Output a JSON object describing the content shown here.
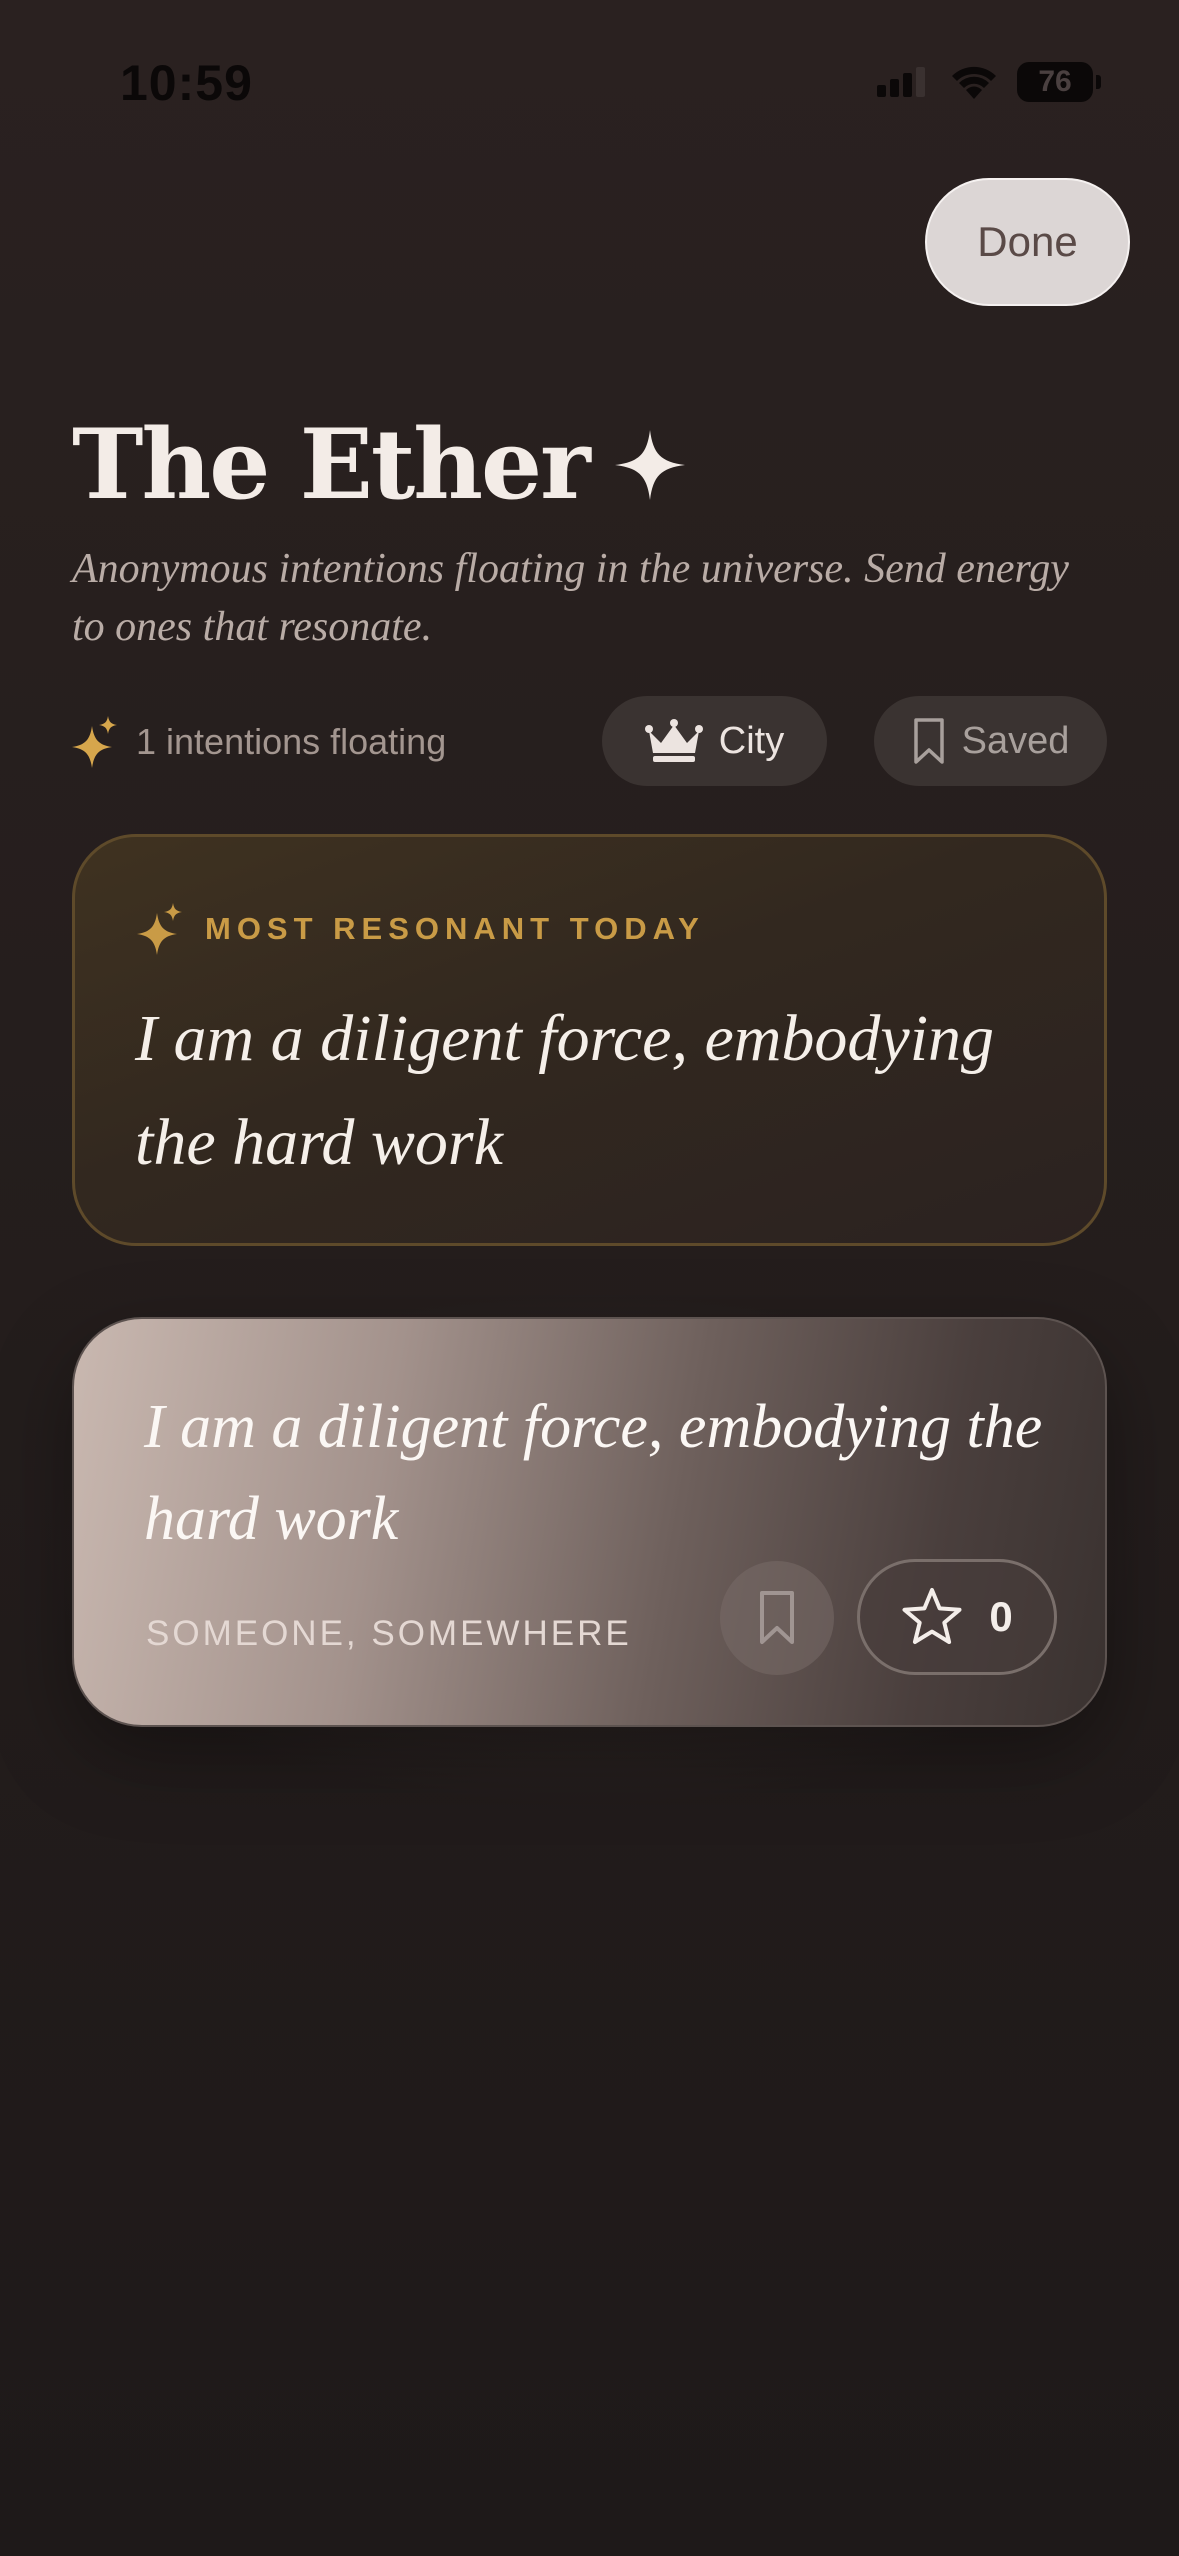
{
  "status_bar": {
    "time": "10:59",
    "battery": "76"
  },
  "header": {
    "done_label": "Done",
    "title": "The Ether",
    "subtitle": "Anonymous intentions floating in the universe. Send energy to ones that resonate."
  },
  "meta": {
    "intentions_count": "1 intentions floating",
    "city_label": "City",
    "saved_label": "Saved"
  },
  "featured": {
    "label": "MOST RESONANT TODAY",
    "text": "I am a diligent force, embodying the hard work"
  },
  "intentions": [
    {
      "text": "I am a diligent force, embodying the hard work",
      "author": "SOMEONE, SOMEWHERE",
      "energy_count": "0"
    }
  ],
  "colors": {
    "background": "#251e1d",
    "accent_gold": "#c99b46",
    "text_primary": "#f3ece7",
    "text_muted": "#a39690"
  },
  "icons": {
    "title": "sparkle-icon",
    "count": "sparkles-icon",
    "city": "crown-icon",
    "saved": "bookmark-icon",
    "energy": "star-icon"
  }
}
